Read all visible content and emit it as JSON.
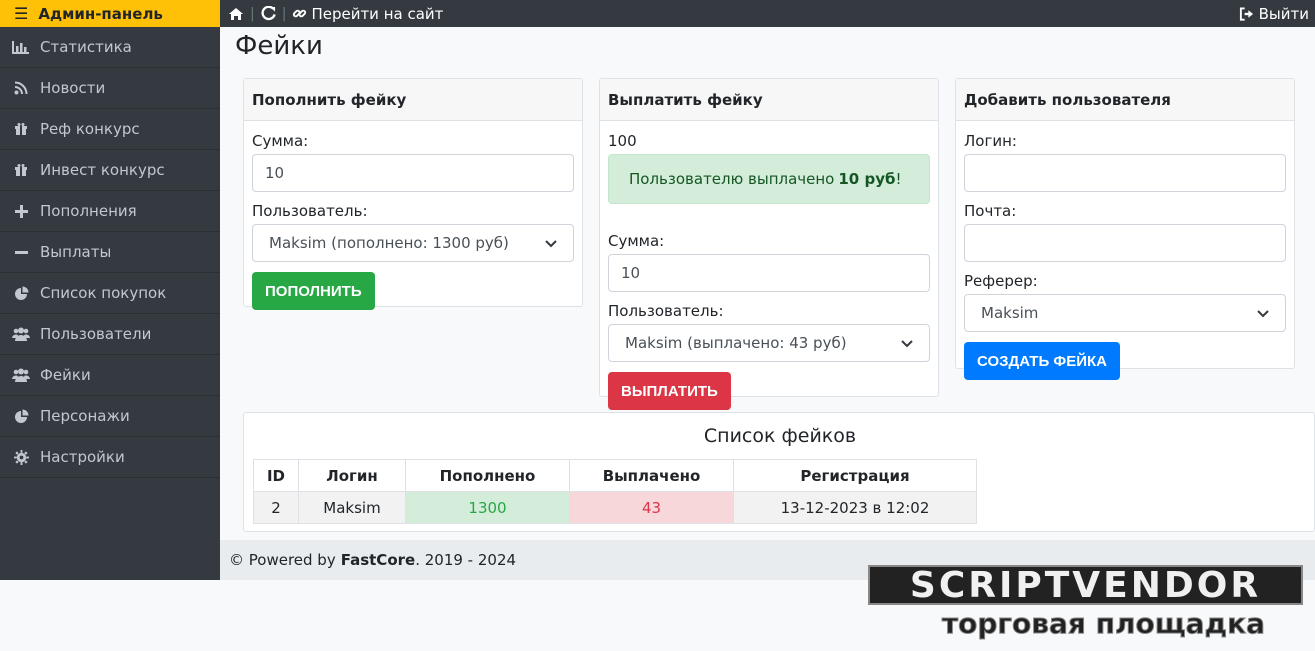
{
  "topbar": {
    "brand": "Админ-панель",
    "go_site": "Перейти на сайт",
    "logout": "Выйти"
  },
  "sidebar": {
    "items": [
      {
        "label": "Статистика",
        "icon": "bar-chart-icon"
      },
      {
        "label": "Новости",
        "icon": "rss-icon"
      },
      {
        "label": "Реф конкурс",
        "icon": "gift-icon"
      },
      {
        "label": "Инвест конкурс",
        "icon": "gift-icon"
      },
      {
        "label": "Пополнения",
        "icon": "plus-icon"
      },
      {
        "label": "Выплаты",
        "icon": "minus-icon"
      },
      {
        "label": "Список покупок",
        "icon": "pie-chart-icon"
      },
      {
        "label": "Пользователи",
        "icon": "users-icon"
      },
      {
        "label": "Фейки",
        "icon": "users-icon"
      },
      {
        "label": "Персонажи",
        "icon": "pie-chart-icon"
      },
      {
        "label": "Настройки",
        "icon": "gear-icon"
      }
    ]
  },
  "page": {
    "title": "Фейки"
  },
  "deposit_card": {
    "title": "Пополнить фейку",
    "amount_label": "Сумма:",
    "amount_value": "10",
    "user_label": "Пользователь:",
    "user_selected": "Maksim (пополнено: 1300 руб)",
    "button": "ПОПОЛНИТЬ"
  },
  "payout_card": {
    "title": "Выплатить фейку",
    "top_value": "100",
    "alert_prefix": "Пользователю выплачено ",
    "alert_amount": "10 руб",
    "alert_suffix": "!",
    "amount_label": "Сумма:",
    "amount_value": "10",
    "user_label": "Пользователь:",
    "user_selected": "Maksim (выплачено: 43 руб)",
    "button": "ВЫПЛАТИТЬ"
  },
  "add_user_card": {
    "title": "Добавить пользователя",
    "login_label": "Логин:",
    "login_value": "",
    "email_label": "Почта:",
    "email_value": "",
    "referrer_label": "Реферер:",
    "referrer_selected": "Maksim",
    "button": "СОЗДАТЬ ФЕЙКА"
  },
  "fakes_table": {
    "title": "Список фейков",
    "headers": [
      "ID",
      "Логин",
      "Пополнено",
      "Выплачено",
      "Регистрация"
    ],
    "rows": [
      {
        "id": "2",
        "login": "Maksim",
        "deposited": "1300",
        "paid": "43",
        "registered": "13-12-2023 в 12:02"
      }
    ]
  },
  "footer": {
    "prefix": "© Powered by",
    "brand": "FastCore",
    "years": ". 2019 - 2024"
  },
  "watermark": {
    "title": "SCRIPTVENDOR",
    "subtitle": "торговая площадка"
  },
  "colors": {
    "brand_yellow": "#ffc107",
    "sidebar_dark": "#343a40",
    "success": "#28a745",
    "danger": "#dc3545",
    "primary": "#007bff"
  }
}
